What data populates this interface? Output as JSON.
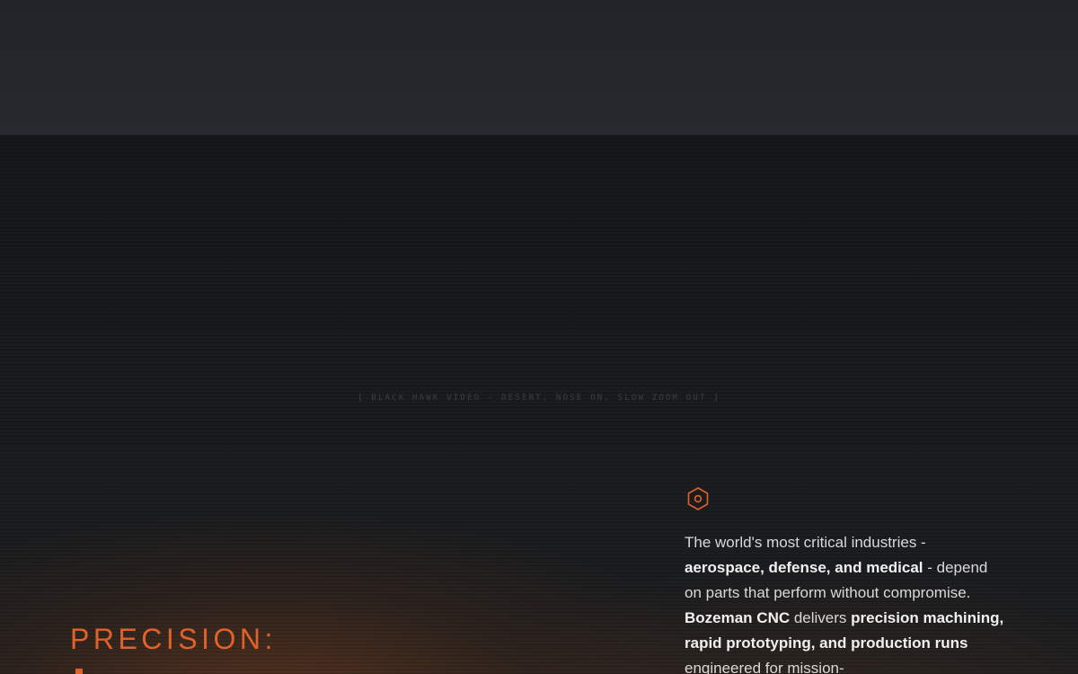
{
  "hero": {
    "video_placeholder": "[ BLACK HAWK VIDEO - DESERT, NOSE ON, SLOW ZOOM OUT ]",
    "title": "PRECISION:",
    "intro": {
      "part1": "The world's most critical industries - ",
      "part2": "aerospace, defense, and medical",
      "part3": " - depend on parts that perform without compromise. ",
      "part4": "Bozeman CNC",
      "part5": " delivers ",
      "part6": "precision machining, rapid prototyping, and production runs",
      "part7": " engineered for mission-"
    }
  },
  "colors": {
    "accent": "#e0622a",
    "background": "#16181b",
    "top_band": "#24272b",
    "text": "#d9d9d9"
  },
  "icons": {
    "feature_icon": "hex-nut-icon"
  }
}
